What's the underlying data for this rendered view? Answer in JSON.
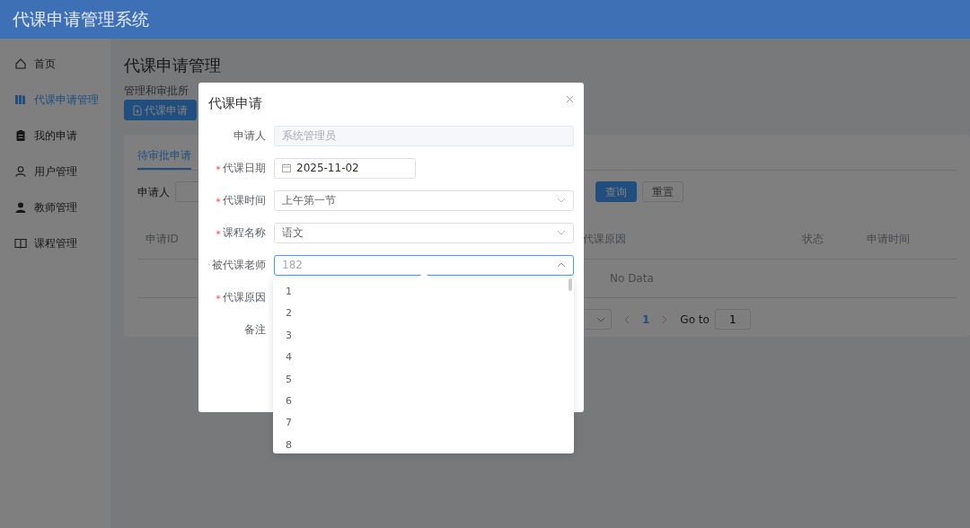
{
  "header": {
    "title": "代课申请管理系统"
  },
  "sidebar": {
    "items": [
      {
        "label": "首页",
        "selected": false
      },
      {
        "label": "代课申请管理",
        "selected": true
      },
      {
        "label": "我的申请",
        "selected": false
      },
      {
        "label": "用户管理",
        "selected": false
      },
      {
        "label": "教师管理",
        "selected": false
      },
      {
        "label": "课程管理",
        "selected": false
      }
    ]
  },
  "page": {
    "title": "代课申请管理",
    "subtitle": "管理和审批所",
    "new_button": "代课申请"
  },
  "tabs": [
    {
      "label": "待审批申请",
      "selected": true
    }
  ],
  "filter": {
    "label": "申请人",
    "buttons": [
      {
        "label": "查询",
        "kind": "primary"
      },
      {
        "label": "重置",
        "kind": "default"
      }
    ]
  },
  "table": {
    "columns": [
      "申请ID",
      "代课原因",
      "状态",
      "申请时间"
    ],
    "empty_text": "No Data"
  },
  "pagination": {
    "current": "1",
    "goto_label": "Go to",
    "goto_value": "1"
  },
  "dialog": {
    "title": "代课申请",
    "fields": [
      {
        "label": "申请人",
        "required": false,
        "kind": "text",
        "value": "系统管理员",
        "disabled": true
      },
      {
        "label": "代课日期",
        "required": true,
        "kind": "date",
        "value": "2025-11-02"
      },
      {
        "label": "代课时间",
        "required": true,
        "kind": "select",
        "value": "上午第一节",
        "expanded": false
      },
      {
        "label": "课程名称",
        "required": true,
        "kind": "select",
        "value": "语文",
        "expanded": false
      },
      {
        "label": "被代课老师",
        "required": true,
        "kind": "select",
        "placeholder": "182",
        "expanded": true
      },
      {
        "label": "代课原因",
        "required": true
      },
      {
        "label": "备注",
        "required": false
      }
    ],
    "dropdown": {
      "options": [
        {
          "label": "1",
          "selected": false
        },
        {
          "label": "2",
          "selected": false
        },
        {
          "label": "3",
          "selected": false
        },
        {
          "label": "4",
          "selected": false
        },
        {
          "label": "5",
          "selected": false
        },
        {
          "label": "6",
          "selected": false
        },
        {
          "label": "7",
          "selected": false
        },
        {
          "label": "8",
          "selected": false
        }
      ]
    }
  }
}
